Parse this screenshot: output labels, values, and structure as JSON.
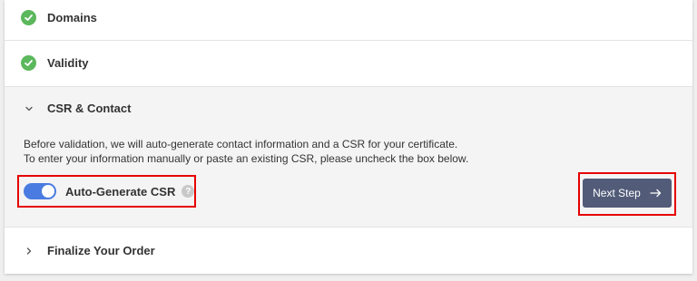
{
  "steps": {
    "domains": {
      "label": "Domains",
      "status": "complete"
    },
    "validity": {
      "label": "Validity",
      "status": "complete"
    },
    "csr": {
      "label": "CSR & Contact",
      "expanded": true,
      "description_line1": "Before validation, we will auto-generate contact information and a CSR for your certificate.",
      "description_line2": "To enter your information manually or paste an existing CSR, please uncheck the box below.",
      "toggle_label": "Auto-Generate CSR",
      "toggle_on": true,
      "help_icon_glyph": "?",
      "next_button_label": "Next Step"
    },
    "finalize": {
      "label": "Finalize Your Order",
      "expanded": false
    }
  },
  "colors": {
    "check_green": "#5cb85c",
    "toggle_blue": "#4a7be0",
    "button_bg": "#525c79",
    "highlight_red": "#e60000",
    "active_step_bg": "#f4f4f5"
  },
  "icons": {
    "complete": "check-circle-icon",
    "expanded": "chevron-down-icon",
    "collapsed": "chevron-right-icon",
    "help": "question-circle-icon",
    "next": "arrow-right-icon"
  }
}
